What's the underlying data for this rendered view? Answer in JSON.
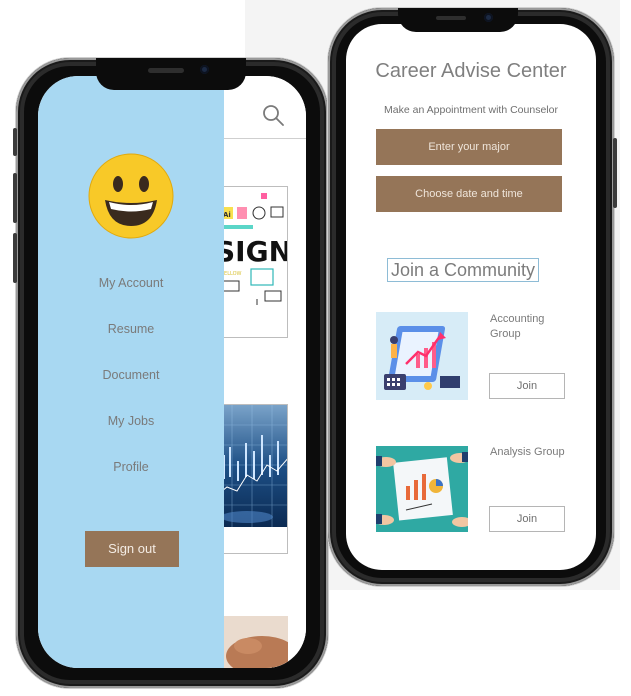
{
  "drawer": {
    "menu": [
      "My Account",
      "Resume",
      "Document",
      "My Jobs",
      "Profile"
    ],
    "sign_out": "Sign out"
  },
  "background_thumb": {
    "design_text": "SIGN",
    "ai_badge": "Ai",
    "yellow_text": "YELLOW"
  },
  "career": {
    "title": "Career Advise Center",
    "subtitle": "Make an Appointment with Counselor",
    "major_button": "Enter your major",
    "date_button": "Choose date and time",
    "community_title": "Join a Community",
    "groups": [
      {
        "label": "Accounting Group",
        "join": "Join"
      },
      {
        "label": "Analysis Group",
        "join": "Join"
      }
    ]
  },
  "colors": {
    "drawer_bg": "#a8d8f2",
    "brown_button": "#957558"
  }
}
